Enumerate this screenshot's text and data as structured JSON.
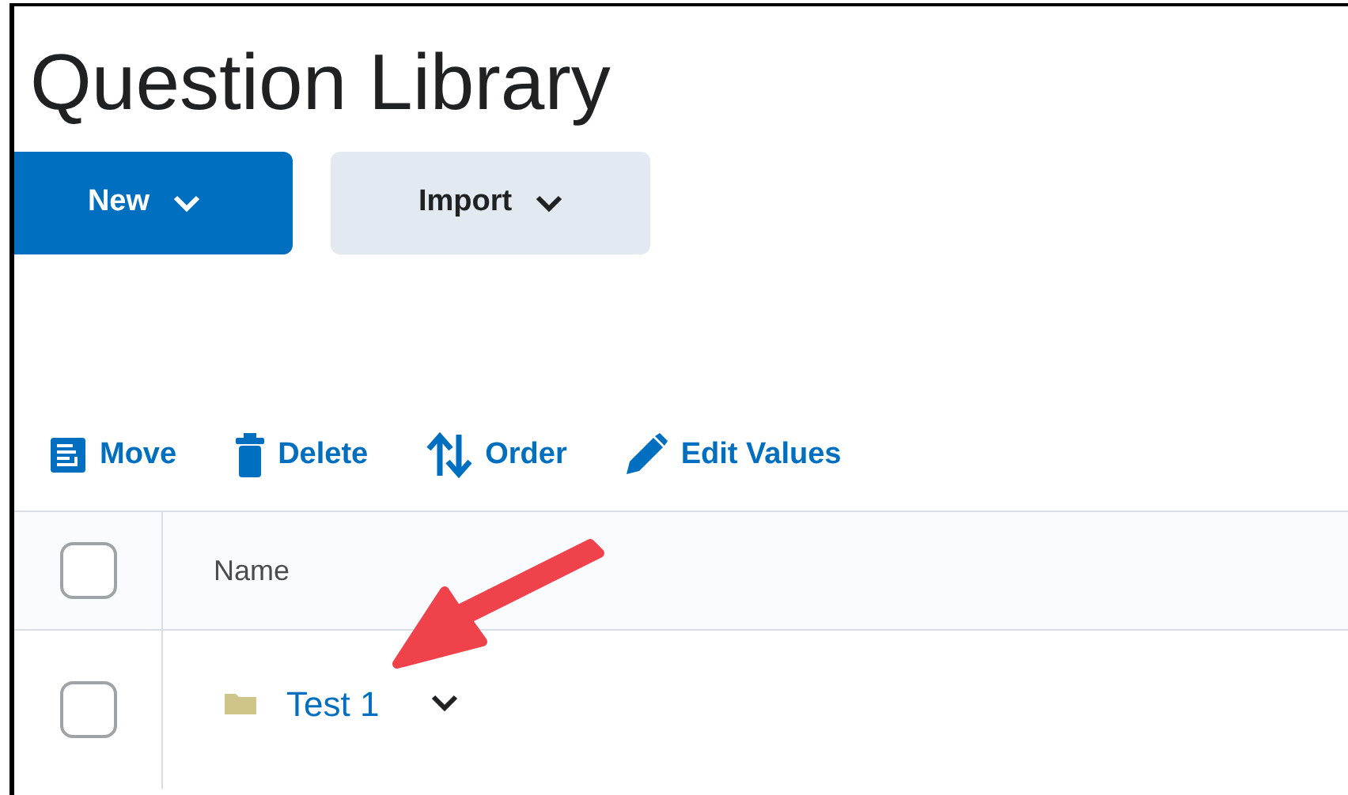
{
  "page": {
    "title": "Question Library"
  },
  "buttons": [
    {
      "label": "New",
      "kind": "primary"
    },
    {
      "label": "Import",
      "kind": "secondary"
    }
  ],
  "toolbar": [
    {
      "label": "Move",
      "kind": "move"
    },
    {
      "label": "Delete",
      "kind": "delete"
    },
    {
      "label": "Order",
      "kind": "order"
    },
    {
      "label": "Edit Values",
      "kind": "edit"
    }
  ],
  "table": {
    "columns": [
      "Name"
    ],
    "header_checked": false,
    "rows": [
      {
        "name": "Test 1",
        "checked": false
      }
    ]
  }
}
